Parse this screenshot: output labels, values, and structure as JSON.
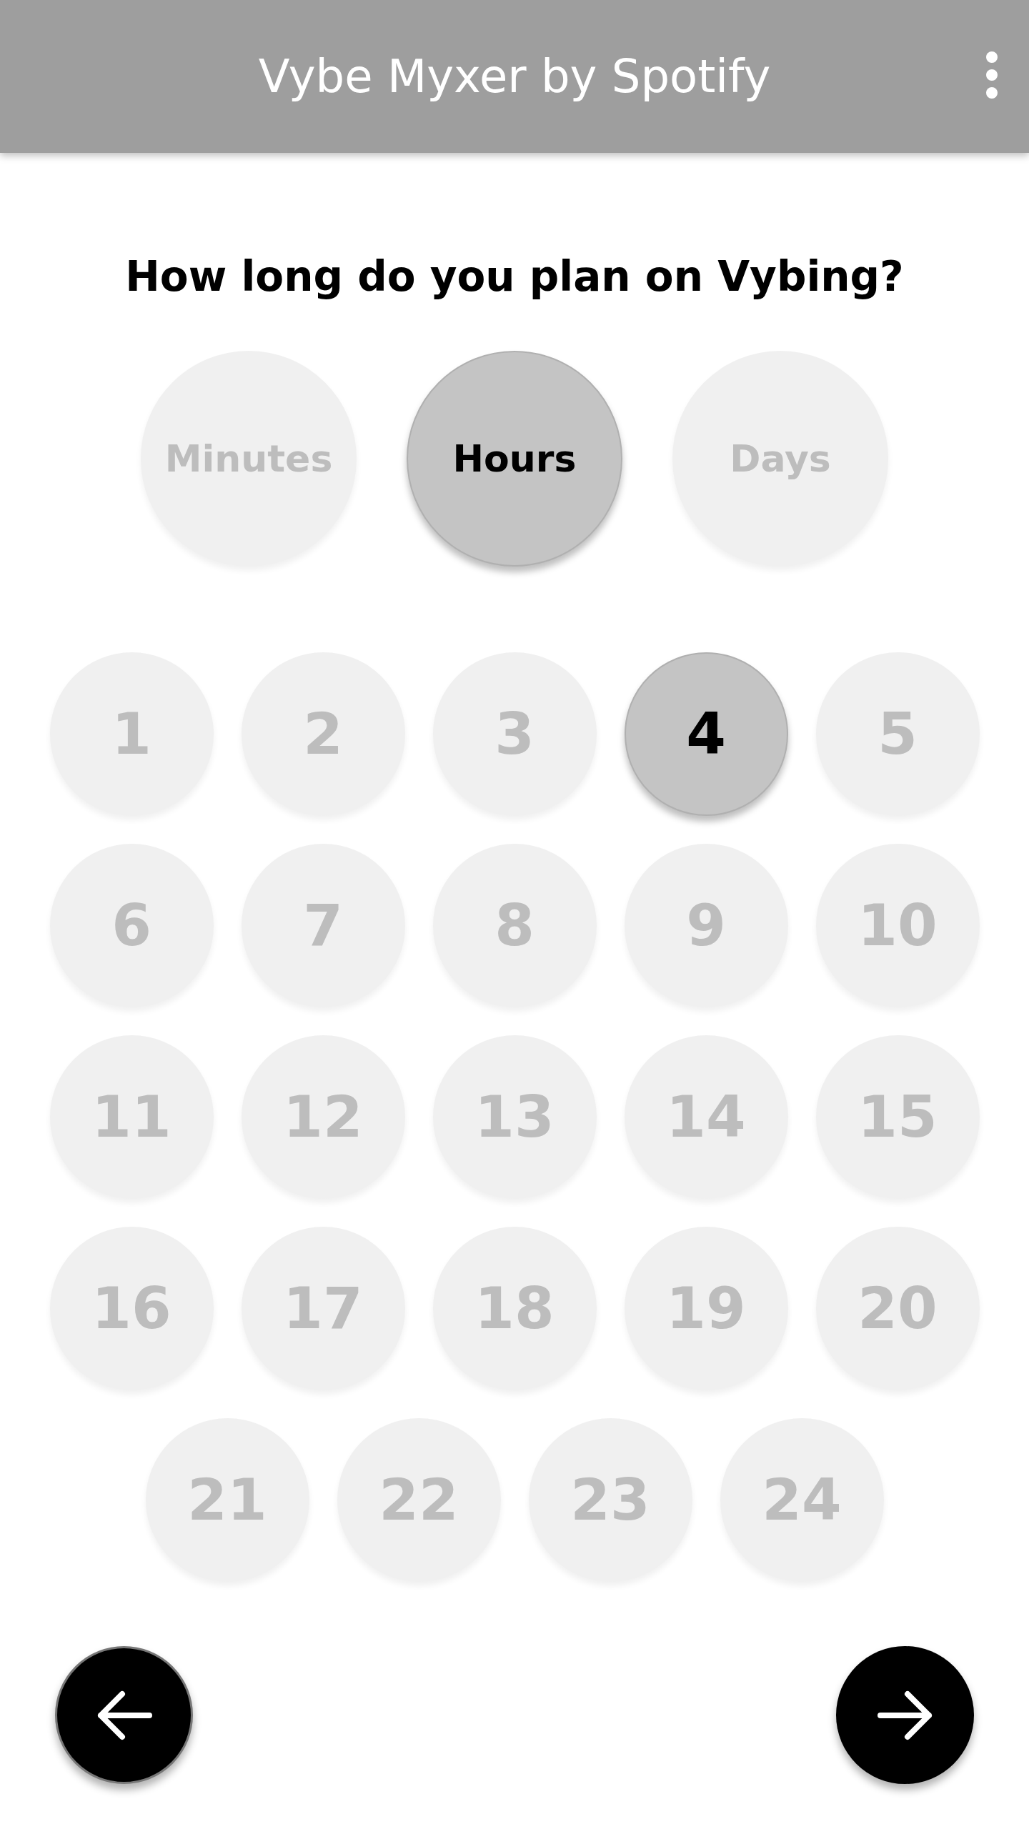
{
  "app_bar": {
    "title": "Vybe Myxer by Spotify"
  },
  "question": "How long do you plan on Vybing?",
  "units": [
    {
      "label": "Minutes",
      "selected": false
    },
    {
      "label": "Hours",
      "selected": true
    },
    {
      "label": "Days",
      "selected": false
    }
  ],
  "numbers": [
    {
      "label": "1",
      "selected": false
    },
    {
      "label": "2",
      "selected": false
    },
    {
      "label": "3",
      "selected": false
    },
    {
      "label": "4",
      "selected": true
    },
    {
      "label": "5",
      "selected": false
    },
    {
      "label": "6",
      "selected": false
    },
    {
      "label": "7",
      "selected": false
    },
    {
      "label": "8",
      "selected": false
    },
    {
      "label": "9",
      "selected": false
    },
    {
      "label": "10",
      "selected": false
    },
    {
      "label": "11",
      "selected": false
    },
    {
      "label": "12",
      "selected": false
    },
    {
      "label": "13",
      "selected": false
    },
    {
      "label": "14",
      "selected": false
    },
    {
      "label": "15",
      "selected": false
    },
    {
      "label": "16",
      "selected": false
    },
    {
      "label": "17",
      "selected": false
    },
    {
      "label": "18",
      "selected": false
    },
    {
      "label": "19",
      "selected": false
    },
    {
      "label": "20",
      "selected": false
    },
    {
      "label": "21",
      "selected": false
    },
    {
      "label": "22",
      "selected": false
    },
    {
      "label": "23",
      "selected": false
    },
    {
      "label": "24",
      "selected": false
    }
  ]
}
